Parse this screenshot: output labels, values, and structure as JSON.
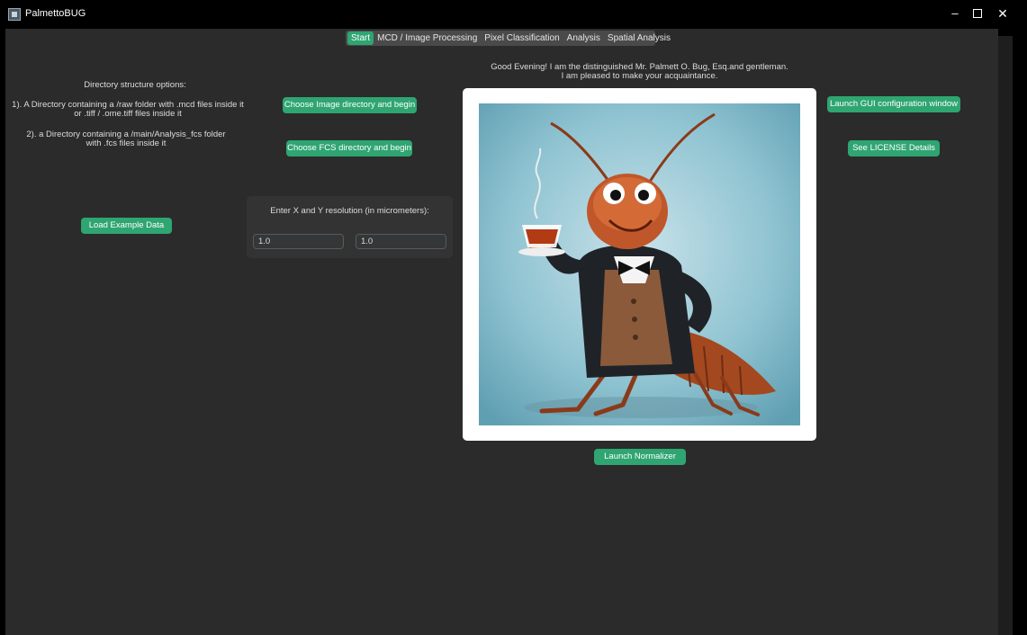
{
  "window": {
    "title": "PalmettoBUG",
    "controls": {
      "minimize": "–",
      "close": "✕"
    }
  },
  "tabs": [
    {
      "label": "Start",
      "active": true
    },
    {
      "label": "MCD / Image Processing",
      "active": false
    },
    {
      "label": "Pixel Classification",
      "active": false
    },
    {
      "label": "Analysis",
      "active": false
    },
    {
      "label": "Spatial Analysis",
      "active": false
    }
  ],
  "directory_info": {
    "heading": "Directory structure options:",
    "option1_line1": "1). A Directory containing a /raw folder with .mcd files inside it",
    "option1_line2": "or .tiff / .ome.tiff files inside it",
    "option2_line1": "2). a Directory containing a /main/Analysis_fcs folder",
    "option2_line2": "with  .fcs files inside it"
  },
  "buttons": {
    "choose_image_dir": "Choose Image directory and begin",
    "choose_fcs_dir": "Choose FCS directory and begin",
    "load_example": "Load Example Data",
    "launch_gui_config": "Launch GUI configuration window",
    "see_license": "See LICENSE Details",
    "launch_normalizer": "Launch Normalizer"
  },
  "resolution": {
    "label": "Enter X and Y resolution (in micrometers):",
    "x_value": "1.0",
    "y_value": "1.0"
  },
  "greeting": {
    "line1": "Good Evening! I am the distinguished Mr. Palmett O. Bug, Esq.and gentleman.",
    "line2": "I am pleased to make your acquaintance."
  },
  "colors": {
    "accent": "#2fa572",
    "panel_bg": "#2b2b2b",
    "titlebar_bg": "#000000"
  }
}
